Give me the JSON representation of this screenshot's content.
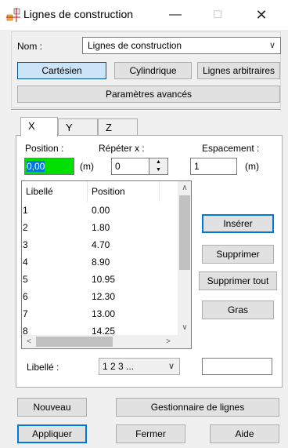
{
  "window": {
    "title": "Lignes de construction",
    "minimize": "—",
    "maximize": "☐",
    "close": "✕"
  },
  "name": {
    "label": "Nom :",
    "value": "Lignes de construction"
  },
  "coord_buttons": [
    "Cartésien",
    "Cylindrique",
    "Lignes arbitraires"
  ],
  "advanced_label": "Paramètres avancés",
  "tabs": [
    "X",
    "Y",
    "Z"
  ],
  "fields": {
    "position_label": "Position :",
    "position_value": "0,00",
    "position_unit": "(m)",
    "repeat_label": "Répéter x :",
    "repeat_value": "0",
    "spacing_label": "Espacement :",
    "spacing_value": "1",
    "spacing_unit": "(m)"
  },
  "list": {
    "headers": [
      "Libellé",
      "Position"
    ],
    "rows": [
      {
        "label": "1",
        "position": "0.00"
      },
      {
        "label": "2",
        "position": "1.80"
      },
      {
        "label": "3",
        "position": "4.70"
      },
      {
        "label": "4",
        "position": "8.90"
      },
      {
        "label": "5",
        "position": "10.95"
      },
      {
        "label": "6",
        "position": "12.30"
      },
      {
        "label": "7",
        "position": "13.00"
      },
      {
        "label": "8",
        "position": "14.25"
      }
    ]
  },
  "actions": {
    "insert": "Insérer",
    "delete": "Supprimer",
    "delete_all": "Supprimer tout",
    "bold": "Gras"
  },
  "label_select": {
    "label": "Libellé :",
    "value": "1 2 3 ..."
  },
  "bottom": {
    "new": "Nouveau",
    "manager": "Gestionnaire de lignes",
    "apply": "Appliquer",
    "close": "Fermer",
    "help": "Aide"
  },
  "colors": {
    "active_field": "#00e000",
    "selected_button": "#cce4f7",
    "accent": "#0078d7"
  }
}
